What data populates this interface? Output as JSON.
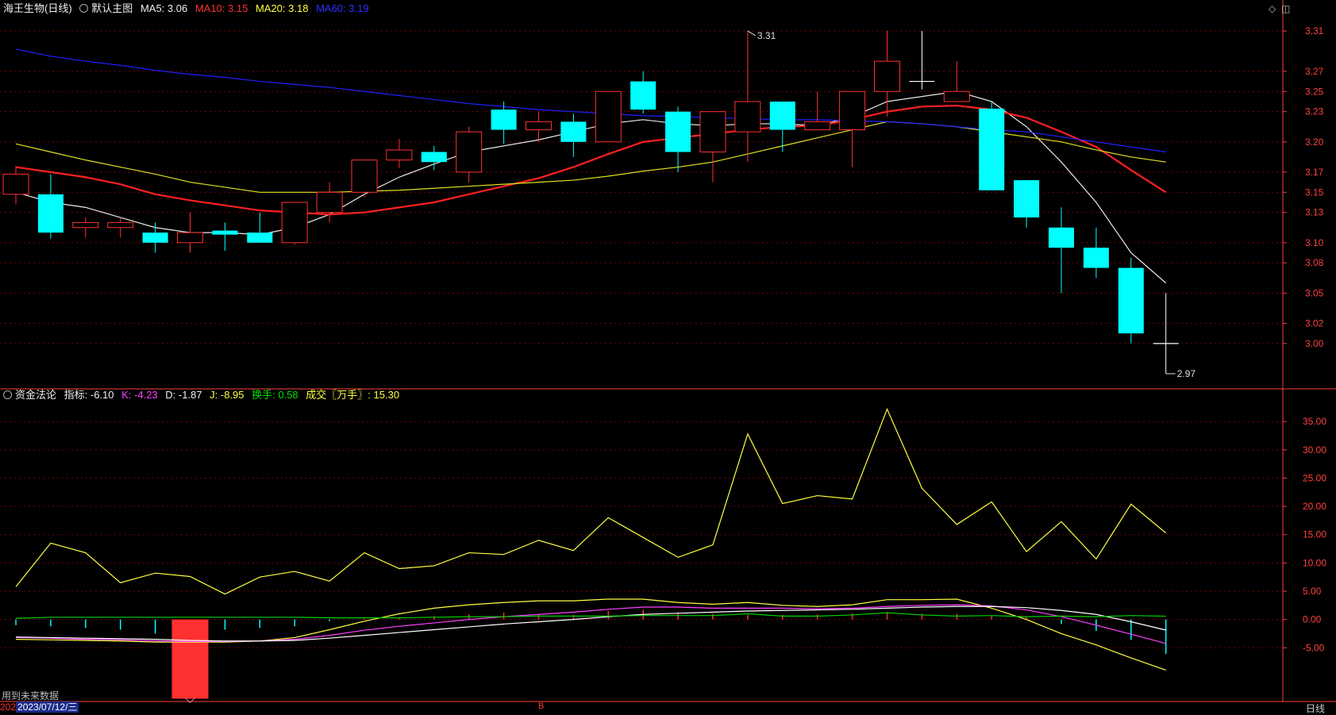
{
  "header": {
    "stock": "海王生物(日线)",
    "template": "默认主图",
    "ma5": "MA5: 3.06",
    "ma10": "MA10: 3.15",
    "ma20": "MA20: 3.18",
    "ma60": "MA60: 3.19"
  },
  "indicator_header": {
    "name": "资金法论",
    "value": "指标: -6.10",
    "k": "K: -4.23",
    "d": "D: -1.87",
    "j": "J: -8.95",
    "turnover": "换手: 0.58",
    "volume": "成交〖万手〗: 15.30"
  },
  "footer": {
    "hint": "用到未来数据",
    "date_prefix": "202",
    "date": "2023/07/12/三",
    "marker": "B",
    "period": "日线"
  },
  "colors": {
    "up": "#ff3030",
    "down": "#00ffff",
    "ma5": "#e8e8e8",
    "ma10": "#ff2020",
    "ma20": "#e0e020",
    "ma60": "#2020ff",
    "k": "#ff40ff",
    "d": "#ffffff",
    "j": "#ffff40",
    "green": "#00d000",
    "axis": "#ff4040"
  },
  "chart_data": [
    {
      "type": "candlestick",
      "ylim": [
        2.97,
        3.31
      ],
      "yticks": [
        "3.31",
        "3.27",
        "3.25",
        "3.23",
        "3.20",
        "3.17",
        "3.15",
        "3.13",
        "3.10",
        "3.08",
        "3.05",
        "3.02",
        "3.00"
      ],
      "annotations": {
        "high": "3.31",
        "low": "2.97"
      },
      "candles": [
        {
          "o": 3.148,
          "h": 3.176,
          "l": 3.138,
          "c": 3.168
        },
        {
          "o": 3.148,
          "h": 3.168,
          "l": 3.104,
          "c": 3.11
        },
        {
          "o": 3.115,
          "h": 3.125,
          "l": 3.105,
          "c": 3.12
        },
        {
          "o": 3.115,
          "h": 3.125,
          "l": 3.105,
          "c": 3.12
        },
        {
          "o": 3.11,
          "h": 3.12,
          "l": 3.09,
          "c": 3.1
        },
        {
          "o": 3.1,
          "h": 3.13,
          "l": 3.09,
          "c": 3.11
        },
        {
          "o": 3.112,
          "h": 3.12,
          "l": 3.092,
          "c": 3.108
        },
        {
          "o": 3.11,
          "h": 3.13,
          "l": 3.1,
          "c": 3.1
        },
        {
          "o": 3.1,
          "h": 3.14,
          "l": 3.098,
          "c": 3.14
        },
        {
          "o": 3.13,
          "h": 3.16,
          "l": 3.12,
          "c": 3.15
        },
        {
          "o": 3.15,
          "h": 3.182,
          "l": 3.145,
          "c": 3.182
        },
        {
          "o": 3.182,
          "h": 3.203,
          "l": 3.174,
          "c": 3.192
        },
        {
          "o": 3.19,
          "h": 3.196,
          "l": 3.172,
          "c": 3.18
        },
        {
          "o": 3.17,
          "h": 3.215,
          "l": 3.16,
          "c": 3.21
        },
        {
          "o": 3.232,
          "h": 3.24,
          "l": 3.198,
          "c": 3.212
        },
        {
          "o": 3.212,
          "h": 3.23,
          "l": 3.2,
          "c": 3.22
        },
        {
          "o": 3.22,
          "h": 3.228,
          "l": 3.185,
          "c": 3.2
        },
        {
          "o": 3.2,
          "h": 3.25,
          "l": 3.2,
          "c": 3.25
        },
        {
          "o": 3.26,
          "h": 3.27,
          "l": 3.228,
          "c": 3.232
        },
        {
          "o": 3.23,
          "h": 3.235,
          "l": 3.17,
          "c": 3.19
        },
        {
          "o": 3.19,
          "h": 3.23,
          "l": 3.16,
          "c": 3.23
        },
        {
          "o": 3.21,
          "h": 3.31,
          "l": 3.18,
          "c": 3.24
        },
        {
          "o": 3.24,
          "h": 3.24,
          "l": 3.19,
          "c": 3.212
        },
        {
          "o": 3.212,
          "h": 3.25,
          "l": 3.212,
          "c": 3.22
        },
        {
          "o": 3.212,
          "h": 3.25,
          "l": 3.175,
          "c": 3.25
        },
        {
          "o": 3.25,
          "h": 3.31,
          "l": 3.225,
          "c": 3.28
        },
        {
          "o": 3.26,
          "h": 3.31,
          "l": 3.252,
          "c": 3.26
        },
        {
          "o": 3.24,
          "h": 3.28,
          "l": 3.24,
          "c": 3.25
        },
        {
          "o": 3.233,
          "h": 3.24,
          "l": 3.152,
          "c": 3.152
        },
        {
          "o": 3.162,
          "h": 3.162,
          "l": 3.115,
          "c": 3.125
        },
        {
          "o": 3.115,
          "h": 3.135,
          "l": 3.05,
          "c": 3.095
        },
        {
          "o": 3.095,
          "h": 3.115,
          "l": 3.065,
          "c": 3.075
        },
        {
          "o": 3.075,
          "h": 3.085,
          "l": 3.0,
          "c": 3.01
        },
        {
          "o": 3.0,
          "h": 3.05,
          "l": 2.97,
          "c": 3.0
        }
      ],
      "series": [
        {
          "name": "MA5",
          "values": [
            3.15,
            3.14,
            3.135,
            3.125,
            3.115,
            3.11,
            3.11,
            3.108,
            3.115,
            3.128,
            3.148,
            3.165,
            3.178,
            3.19,
            3.196,
            3.202,
            3.21,
            3.218,
            3.222,
            3.218,
            3.216,
            3.218,
            3.218,
            3.216,
            3.225,
            3.24,
            3.245,
            3.25,
            3.24,
            3.215,
            3.18,
            3.14,
            3.09,
            3.06
          ]
        },
        {
          "name": "MA10",
          "values": [
            3.175,
            3.17,
            3.165,
            3.158,
            3.148,
            3.142,
            3.137,
            3.132,
            3.13,
            3.128,
            3.13,
            3.135,
            3.14,
            3.148,
            3.156,
            3.164,
            3.175,
            3.188,
            3.2,
            3.204,
            3.208,
            3.212,
            3.215,
            3.216,
            3.222,
            3.23,
            3.235,
            3.236,
            3.232,
            3.224,
            3.21,
            3.195,
            3.172,
            3.15
          ]
        },
        {
          "name": "MA20",
          "values": [
            3.198,
            3.19,
            3.182,
            3.175,
            3.168,
            3.16,
            3.155,
            3.15,
            3.15,
            3.15,
            3.151,
            3.152,
            3.154,
            3.156,
            3.158,
            3.16,
            3.162,
            3.166,
            3.171,
            3.175,
            3.18,
            3.188,
            3.196,
            3.204,
            3.212,
            3.22,
            3.218,
            3.215,
            3.21,
            3.205,
            3.2,
            3.192,
            3.185,
            3.18
          ]
        },
        {
          "name": "MA60",
          "values": [
            3.292,
            3.285,
            3.28,
            3.276,
            3.271,
            3.267,
            3.264,
            3.26,
            3.257,
            3.254,
            3.25,
            3.246,
            3.242,
            3.238,
            3.235,
            3.232,
            3.23,
            3.228,
            3.226,
            3.225,
            3.224,
            3.223,
            3.222,
            3.222,
            3.221,
            3.22,
            3.218,
            3.215,
            3.212,
            3.21,
            3.205,
            3.2,
            3.195,
            3.19
          ]
        }
      ]
    },
    {
      "type": "line",
      "ylim": [
        -10,
        38
      ],
      "yticks": [
        "35.00",
        "30.00",
        "25.00",
        "20.00",
        "15.00",
        "10.00",
        "5.00",
        "0.00",
        "-5.00"
      ],
      "series": [
        {
          "name": "换手",
          "values": [
            5.8,
            13.5,
            11.8,
            6.5,
            8.2,
            7.6,
            4.5,
            7.5,
            8.5,
            6.8,
            11.8,
            9.0,
            9.5,
            11.8,
            11.5,
            14.0,
            12.2,
            18.0,
            14.5,
            11.0,
            13.2,
            32.8,
            20.5,
            21.9,
            21.3,
            37.2,
            23.2,
            16.8,
            20.8,
            12.0,
            17.3,
            10.7,
            20.4,
            15.3
          ]
        },
        {
          "name": "J",
          "values": [
            -3.5,
            -3.6,
            -3.7,
            -3.8,
            -4.0,
            -4.0,
            -4.0,
            -3.8,
            -3.2,
            -1.8,
            -0.3,
            1.0,
            2.0,
            2.6,
            3.0,
            3.3,
            3.3,
            3.6,
            3.6,
            3.0,
            2.7,
            3.0,
            2.5,
            2.3,
            2.6,
            3.5,
            3.5,
            3.6,
            2.0,
            0.0,
            -2.5,
            -4.5,
            -6.8,
            -8.95
          ]
        },
        {
          "name": "K",
          "values": [
            -3.2,
            -3.3,
            -3.5,
            -3.6,
            -3.8,
            -3.9,
            -3.9,
            -3.8,
            -3.5,
            -2.8,
            -1.9,
            -1.2,
            -0.6,
            0.0,
            0.5,
            0.9,
            1.3,
            1.8,
            2.2,
            2.2,
            2.0,
            2.0,
            2.0,
            1.9,
            2.0,
            2.3,
            2.5,
            2.6,
            2.4,
            1.7,
            0.5,
            -1.0,
            -2.6,
            -4.23
          ]
        },
        {
          "name": "D",
          "values": [
            -3.1,
            -3.2,
            -3.3,
            -3.4,
            -3.5,
            -3.7,
            -3.8,
            -3.8,
            -3.7,
            -3.3,
            -2.8,
            -2.3,
            -1.8,
            -1.3,
            -0.8,
            -0.4,
            0.0,
            0.5,
            0.9,
            1.1,
            1.3,
            1.5,
            1.6,
            1.7,
            1.8,
            2.0,
            2.2,
            2.3,
            2.3,
            2.1,
            1.6,
            0.9,
            -0.4,
            -1.87
          ]
        },
        {
          "name": "G",
          "values": [
            0.2,
            0.4,
            0.4,
            0.4,
            0.4,
            0.4,
            0.4,
            0.4,
            0.4,
            0.3,
            0.3,
            0.3,
            0.4,
            0.5,
            0.5,
            0.6,
            0.6,
            0.6,
            0.7,
            0.7,
            0.7,
            1.0,
            0.6,
            0.6,
            0.8,
            1.2,
            0.8,
            0.6,
            0.7,
            0.5,
            0.6,
            0.5,
            0.7,
            0.58
          ]
        },
        {
          "name": "指标",
          "values": [
            -1.0,
            -1.2,
            -1.5,
            -1.8,
            -2.5,
            -3.0,
            -1.8,
            -1.5,
            -1.2,
            -0.3,
            0.2,
            0.4,
            0.6,
            0.9,
            1.2,
            1.0,
            0.8,
            1.5,
            1.7,
            1.3,
            1.0,
            0.8,
            0.8,
            0.9,
            1.1,
            1.3,
            1.0,
            1.0,
            0.6,
            0.4,
            -0.8,
            -2.0,
            -3.6,
            -6.1
          ]
        }
      ],
      "bar": {
        "index": 5,
        "value": -14.0
      }
    }
  ]
}
